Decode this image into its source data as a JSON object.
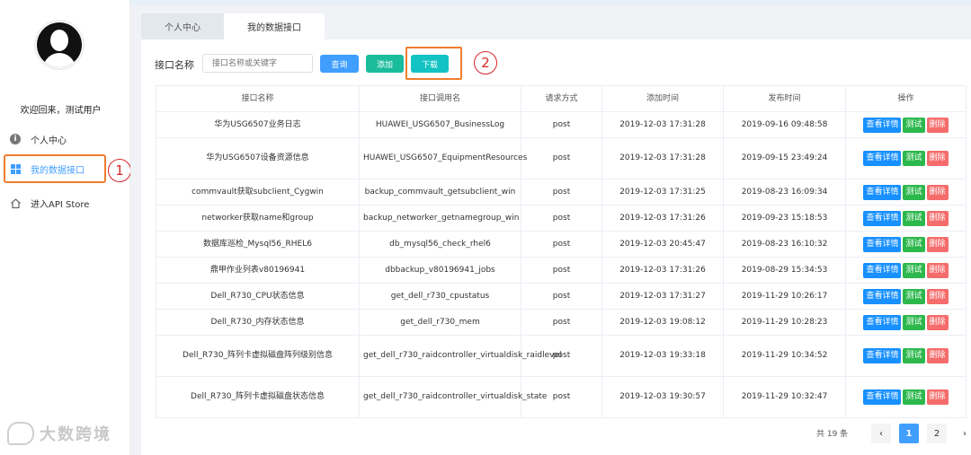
{
  "sidebar": {
    "welcome": "欢迎回来，测试用户",
    "items": [
      {
        "label": "个人中心",
        "icon": "info-icon"
      },
      {
        "label": "我的数据接口",
        "icon": "grid-icon"
      },
      {
        "label": "进入API Store",
        "icon": "home-icon"
      }
    ],
    "annotation_1": "1",
    "watermark": "大数跨境"
  },
  "tabs": [
    {
      "label": "个人中心"
    },
    {
      "label": "我的数据接口"
    }
  ],
  "search": {
    "label": "接口名称",
    "placeholder": "接口名称或关键字",
    "query_label": "查询",
    "add_label": "添加",
    "download_label": "下载",
    "annotation_2": "2"
  },
  "table": {
    "headers": [
      "接口名称",
      "接口调用名",
      "请求方式",
      "添加时间",
      "发布时间",
      "操作"
    ],
    "actions": {
      "view": "查看详情",
      "test": "测试",
      "delete": "删除"
    },
    "rows": [
      {
        "name": "华为USG6507业务日志",
        "call": "HUAWEI_USG6507_BusinessLog",
        "method": "post",
        "added": "2019-12-03 17:31:28",
        "published": "2019-09-16 09:48:58"
      },
      {
        "name": "华为USG6507设备资源信息",
        "call": "HUAWEI_USG6507_EquipmentResources",
        "method": "post",
        "added": "2019-12-03 17:31:28",
        "published": "2019-09-15 23:49:24"
      },
      {
        "name": "commvault获取subclient_Cygwin",
        "call": "backup_commvault_getsubclient_win",
        "method": "post",
        "added": "2019-12-03 17:31:25",
        "published": "2019-08-23 16:09:34"
      },
      {
        "name": "networker获取name和group",
        "call": "backup_networker_getnamegroup_win",
        "method": "post",
        "added": "2019-12-03 17:31:26",
        "published": "2019-09-23 15:18:53"
      },
      {
        "name": "数据库巡检_Mysql56_RHEL6",
        "call": "db_mysql56_check_rhel6",
        "method": "post",
        "added": "2019-12-03 20:45:47",
        "published": "2019-08-23 16:10:32"
      },
      {
        "name": "鼎甲作业列表v80196941",
        "call": "dbbackup_v80196941_jobs",
        "method": "post",
        "added": "2019-12-03 17:31:26",
        "published": "2019-08-29 15:34:53"
      },
      {
        "name": "Dell_R730_CPU状态信息",
        "call": "get_dell_r730_cpustatus",
        "method": "post",
        "added": "2019-12-03 17:31:27",
        "published": "2019-11-29 10:26:17"
      },
      {
        "name": "Dell_R730_内存状态信息",
        "call": "get_dell_r730_mem",
        "method": "post",
        "added": "2019-12-03 19:08:12",
        "published": "2019-11-29 10:28:23"
      },
      {
        "name": "Dell_R730_阵列卡虚拟磁盘阵列级别信息",
        "call": "get_dell_r730_raidcontroller_virtualdisk_raidlevel",
        "method": "post",
        "added": "2019-12-03 19:33:18",
        "published": "2019-11-29 10:34:52"
      },
      {
        "name": "Dell_R730_阵列卡虚拟磁盘状态信息",
        "call": "get_dell_r730_raidcontroller_virtualdisk_state",
        "method": "post",
        "added": "2019-12-03 19:30:57",
        "published": "2019-11-29 10:32:47"
      }
    ]
  },
  "pagination": {
    "total": "共 19 条",
    "prev": "‹",
    "pages": [
      "1",
      "2"
    ],
    "next": "›"
  }
}
